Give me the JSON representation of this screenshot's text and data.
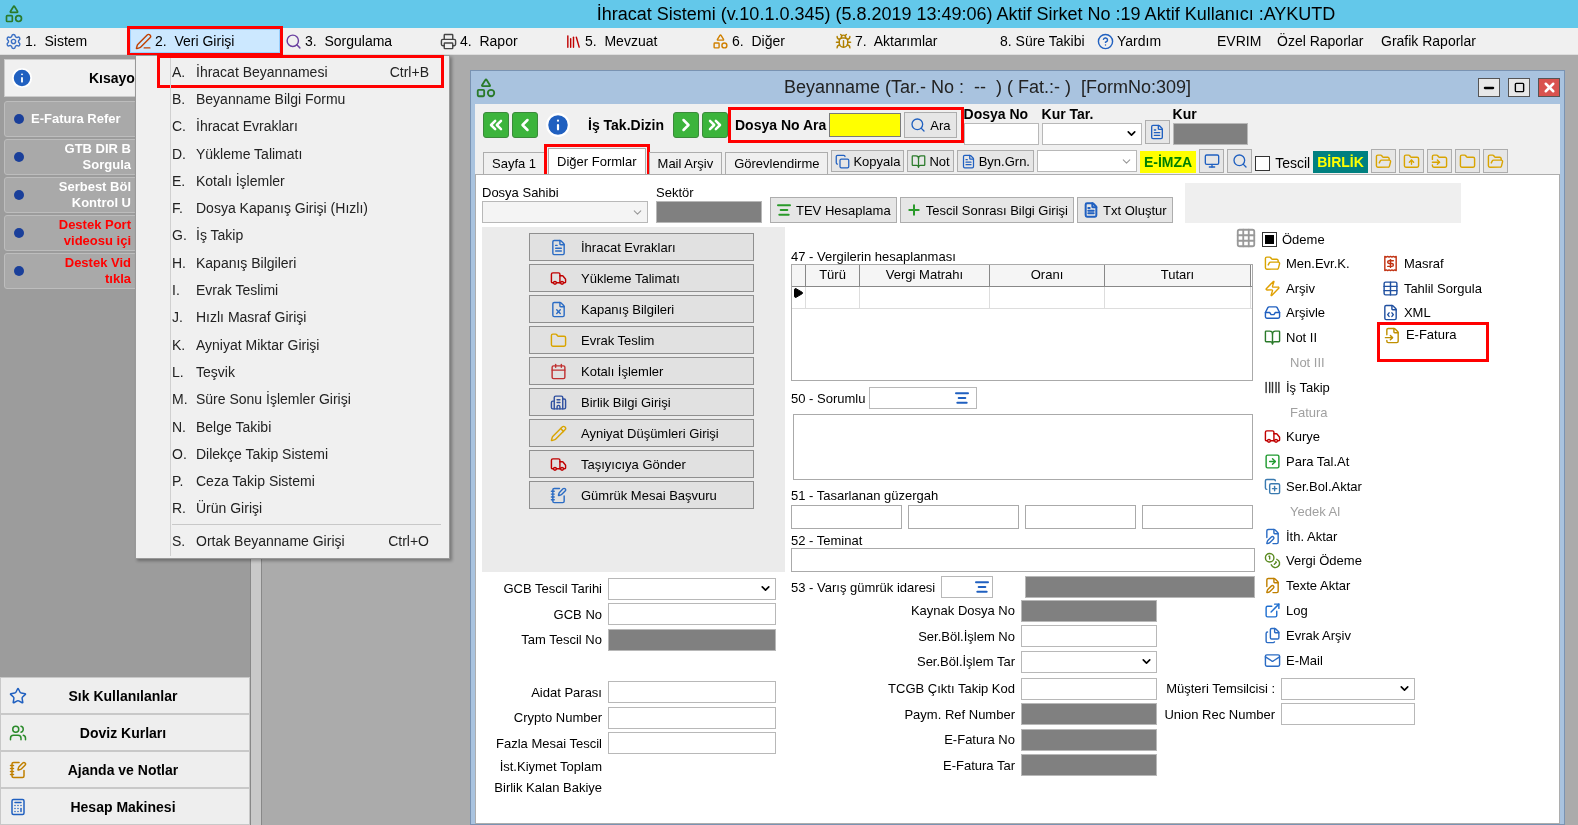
{
  "window": {
    "title": "İhracat Sistemi (v.10.1.0.345) (5.8.2019 13:49:06) Aktif Sirket No :19 Aktif Kullanıcı :AYKUTD"
  },
  "menu_bar": [
    {
      "label": "1.  Sistem",
      "kind": "with_icon",
      "selected": false,
      "highlighted": false
    },
    {
      "label": "2.  Veri Girişi",
      "kind": "with_icon",
      "selected": true,
      "highlighted": true
    },
    {
      "label": "3.  Sorgulama",
      "kind": "with_icon",
      "selected": false,
      "highlighted": false
    },
    {
      "label": "4.  Rapor",
      "kind": "with_icon",
      "selected": false,
      "highlighted": false
    },
    {
      "label": "5.  Mevzuat",
      "kind": "with_icon",
      "selected": false,
      "highlighted": false
    },
    {
      "label": "6.  Diğer",
      "kind": "with_icon",
      "selected": false,
      "highlighted": false
    },
    {
      "label": "7.  Aktarımlar",
      "kind": "with_icon",
      "selected": false,
      "highlighted": false
    },
    {
      "label": "8. Süre Takibi",
      "kind": "plain",
      "selected": false,
      "highlighted": false
    },
    {
      "label": "Yardım",
      "kind": "with_icon",
      "selected": false,
      "highlighted": false
    },
    {
      "label": "EVRIM",
      "kind": "plain",
      "selected": false,
      "highlighted": false
    },
    {
      "label": "Özel Raporlar",
      "kind": "plain",
      "selected": false,
      "highlighted": false
    },
    {
      "label": "Grafik Raporlar",
      "kind": "plain",
      "selected": false,
      "highlighted": false
    }
  ],
  "dropdown_menu": {
    "groups": [
      [
        {
          "key": "A.",
          "label": "İhracat Beyannamesi",
          "shortcut": "Ctrl+B",
          "highlighted": true
        },
        {
          "key": "B.",
          "label": "Beyanname Bilgi Formu",
          "highlighted": false
        },
        {
          "key": "C.",
          "label": "İhracat Evrakları",
          "highlighted": false
        },
        {
          "key": "D.",
          "label": "Yükleme Talimatı",
          "highlighted": false
        },
        {
          "key": "E.",
          "label": "Kotalı İşlemler",
          "highlighted": false
        },
        {
          "key": "F.",
          "label": "Dosya Kapanış Girişi (Hızlı)",
          "highlighted": false
        },
        {
          "key": "G.",
          "label": "İş Takip",
          "highlighted": false
        },
        {
          "key": "H.",
          "label": "Kapanış Bilgileri",
          "highlighted": false
        },
        {
          "key": "I.",
          "label": "Evrak Teslimi",
          "highlighted": false
        },
        {
          "key": "J.",
          "label": "Hızlı Masraf Girişi",
          "highlighted": false
        },
        {
          "key": "K.",
          "label": "Ayniyat Miktar Girişi",
          "highlighted": false
        },
        {
          "key": "L.",
          "label": "Teşvik",
          "highlighted": false
        },
        {
          "key": "M.",
          "label": "Süre Sonu İşlemler Girişi",
          "highlighted": false
        },
        {
          "key": "N.",
          "label": "Belge Takibi",
          "highlighted": false
        },
        {
          "key": "O.",
          "label": "Dilekçe Takip Sistemi",
          "highlighted": false
        },
        {
          "key": "P.",
          "label": "Ceza Takip Sistemi",
          "highlighted": false
        },
        {
          "key": "R.",
          "label": "Ürün Girişi",
          "highlighted": false
        }
      ],
      [
        {
          "key": "S.",
          "label": "Ortak Beyanname Girişi",
          "shortcut": "Ctrl+O",
          "highlighted": false
        }
      ]
    ]
  },
  "sidebar": {
    "header": "Kısayo",
    "links": [
      {
        "label": "E-Fatura Refer",
        "color": "#ffffff"
      },
      {
        "label": "GTB DIR B\nSorgula",
        "color": "#ffffff"
      },
      {
        "label": "Serbest Böl\nKontrol U",
        "color": "#ffffff"
      },
      {
        "label": "Destek Port\nvideosu içi",
        "color": "#ff0000"
      },
      {
        "label": "Destek Vid\ntıkla",
        "color": "#ff0000"
      }
    ],
    "bottom_buttons": [
      "Sık Kullanılanlar",
      "Doviz Kurları",
      "Ajanda ve Notlar",
      "Hesap Makinesi"
    ]
  },
  "form": {
    "title": "Beyanname (Tar.- No :  --  ) ( Fat.:- )  [FormNo:309]",
    "toolbar": {
      "dizin_label": "İş Tak.Dizin",
      "search_label": "Dosya No Ara",
      "search_button": "Ara",
      "search_highlighted": true,
      "fields": [
        {
          "label": "Dosya No",
          "kind": "text"
        },
        {
          "label": "Kur Tar.",
          "kind": "dropdown"
        },
        {
          "label": "Kur",
          "kind": "readonly"
        }
      ]
    },
    "tabs": [
      {
        "label": "Sayfa 1",
        "selected": false,
        "highlighted": false
      },
      {
        "label": "Diğer Formlar",
        "selected": true,
        "highlighted": true
      },
      {
        "label": "Mail Arşiv",
        "selected": false,
        "highlighted": false
      },
      {
        "label": "Görevlendirme",
        "selected": false,
        "highlighted": false
      }
    ],
    "tab_tools": {
      "buttons": [
        "Kopyala",
        "Not",
        "Byn.Grn."
      ],
      "eimza": "E-İMZA",
      "tescil": {
        "label": "Tescil",
        "checked": false
      },
      "birlik": "BİRLİK"
    },
    "top_fields": {
      "owner_label": "Dosya Sahibi",
      "sector_label": "Sektör",
      "buttons": [
        "TEV Hesaplama",
        "Tescil Sonrası Bilgi Girişi",
        "Txt Oluştur"
      ]
    },
    "form_buttons": [
      "İhracat Evrakları",
      "Yükleme Talimatı",
      "Kapanış Bilgileri",
      "Evrak Teslim",
      "Kotalı İşlemler",
      "Birlik Bilgi Girişi",
      "Ayniyat Düşümleri Girişi",
      "Taşıyıcıya Gönder",
      "Gümrük Mesai Başvuru"
    ],
    "tax_table": {
      "title": "47 - Vergilerin hesaplanması",
      "columns": [
        "Türü",
        "Vergi Matrahı",
        "Oranı",
        "Tutarı"
      ]
    },
    "responsible_label": "50 - Sorumlu",
    "route_label": "51 - Tasarlanan güzergah",
    "guarantee_label": "52 - Teminat",
    "destination_label": "53 - Varış gümrük idaresi",
    "mid_fields": [
      {
        "label": "Kaynak Dosya No",
        "kind": "readonly"
      },
      {
        "label": "Ser.Böl.İşlem No",
        "kind": "text"
      },
      {
        "label": "Ser.Böl.İşlem Tar",
        "kind": "dropdown"
      }
    ],
    "lower_fields": [
      {
        "label": "TCGB Çıktı Takip Kod",
        "kind": "text",
        "extra": {
          "label": "Müşteri Temsilcisi :",
          "kind": "dropdown"
        }
      },
      {
        "label": "Paym. Ref Number",
        "kind": "readonly",
        "extra": {
          "label": "Union Rec Number",
          "kind": "text"
        }
      },
      {
        "label": "E-Fatura No",
        "kind": "readonly"
      },
      {
        "label": "E-Fatura Tar",
        "kind": "readonly"
      }
    ],
    "left_fields": [
      [
        {
          "label": "GCB Tescil Tarihi",
          "kind": "dropdown"
        },
        {
          "label": "GCB No",
          "kind": "text"
        },
        {
          "label": "Tam Tescil No",
          "kind": "readonly"
        }
      ],
      [
        {
          "label": "Aidat Parası",
          "kind": "text"
        },
        {
          "label": "Crypto Number",
          "kind": "text"
        },
        {
          "label": "Fazla Mesai Tescil",
          "kind": "text"
        },
        {
          "label": "İst.Kiymet Toplam",
          "kind": "label_only"
        },
        {
          "label": "Birlik Kalan Bakiye",
          "kind": "label_only"
        }
      ]
    ],
    "actions": {
      "payment": {
        "label": "Ödeme",
        "checked": true
      },
      "left": [
        {
          "label": "Men.Evr.K.",
          "disabled": false
        },
        {
          "label": "Arşiv",
          "disabled": false
        },
        {
          "label": "Arşivle",
          "disabled": false
        },
        {
          "label": "Not II",
          "disabled": false
        },
        {
          "label": "Not III",
          "disabled": true
        },
        {
          "label": "İş Takip",
          "disabled": false
        },
        {
          "label": "Fatura",
          "disabled": true
        },
        {
          "label": "Kurye",
          "disabled": false
        },
        {
          "label": "Para Tal.At",
          "disabled": false
        },
        {
          "label": "Ser.Bol.Aktar",
          "disabled": false
        },
        {
          "label": "Yedek Al",
          "disabled": true
        },
        {
          "label": "İth. Aktar",
          "disabled": false
        },
        {
          "label": "Vergi Ödeme",
          "disabled": false
        },
        {
          "label": "Texte Aktar",
          "disabled": false
        },
        {
          "label": "Log",
          "disabled": false
        },
        {
          "label": "Evrak Arşiv",
          "disabled": false
        },
        {
          "label": "E-Mail",
          "disabled": false
        }
      ],
      "right": [
        {
          "label": "Masraf",
          "highlighted": false
        },
        {
          "label": "Tahlil Sorgula",
          "highlighted": false
        },
        {
          "label": "XML",
          "highlighted": false
        },
        {
          "label": "E-Fatura",
          "highlighted": true
        }
      ]
    }
  }
}
